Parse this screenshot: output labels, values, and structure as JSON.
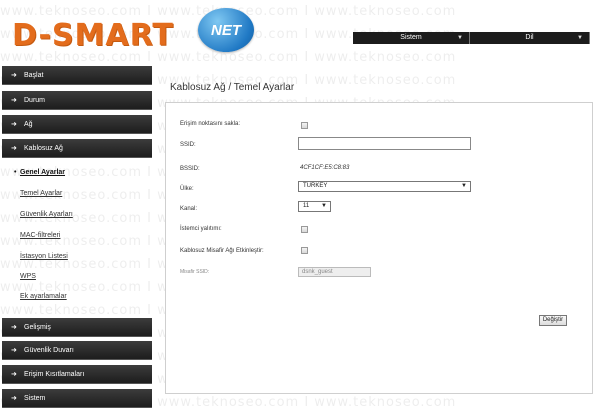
{
  "header": {
    "logo_text": "D-SMART",
    "logo_badge": "NET",
    "menus": [
      {
        "label": "Sistem"
      },
      {
        "label": "Dil"
      }
    ]
  },
  "sidebar": {
    "items": [
      {
        "label": "Başlat"
      },
      {
        "label": "Durum"
      },
      {
        "label": "Ağ"
      },
      {
        "label": "Kablosuz Ağ"
      },
      {
        "label": "Gelişmiş"
      },
      {
        "label": "Güvenlik Duvarı"
      },
      {
        "label": "Erişim Kısıtlamaları"
      },
      {
        "label": "Sistem"
      }
    ],
    "sub_items": [
      {
        "label": "Genel Ayarlar"
      },
      {
        "label": "Temel Ayarlar"
      },
      {
        "label": "Güvenlik Ayarları"
      },
      {
        "label": "MAC-filtreleri"
      },
      {
        "label": "İstasyon Listesi"
      },
      {
        "label": "WPS"
      },
      {
        "label": "Ek ayarlamalar"
      }
    ]
  },
  "main": {
    "title": "Kablosuz Ağ  / Temel Ayarlar",
    "fields": {
      "hide_ap_label": "Erişim noktasını sakla:",
      "ssid_label": "SSID:",
      "ssid_value": "",
      "bssid_label": "BSSID:",
      "bssid_value": "4CF1CF:E5:C8:83",
      "country_label": "Ülke:",
      "country_value": "TURKEY",
      "channel_label": "Kanal:",
      "channel_value": "11",
      "client_isolation_label": "İstemci yalıtımı:",
      "guest_network_label": "Kablosuz Misafir Ağı Etkinleştir:",
      "guest_ssid_label": "Misafir SSID:",
      "guest_ssid_value": "dsnk_guest"
    },
    "apply_label": "Değiştir"
  },
  "watermark": "www.teknoseo.com I www.teknoseo.com I www.teknoseo.com"
}
